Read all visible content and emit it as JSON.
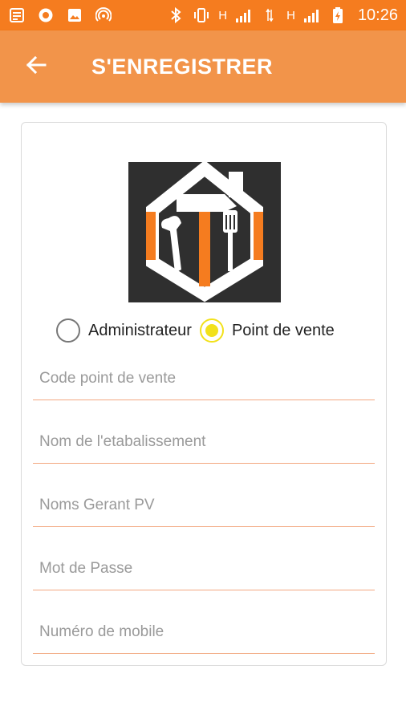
{
  "status_bar": {
    "time": "10:26",
    "network_label_1": "H",
    "network_label_2": "H",
    "icons": [
      "notes-icon",
      "chrome-icon",
      "image-icon",
      "hotspot-icon",
      "bluetooth-icon",
      "vibrate-icon",
      "signal-icon",
      "data-icon",
      "signal-icon",
      "battery-charging-icon"
    ]
  },
  "app_bar": {
    "back_icon": "arrow-left-icon",
    "title": "S'ENREGISTRER",
    "color": "#f2944a"
  },
  "logo": {
    "icon": "house-tools-logo"
  },
  "account_type": {
    "options": [
      {
        "label": "Administrateur",
        "checked": false
      },
      {
        "label": "Point de vente",
        "checked": true
      }
    ],
    "accent": "#f2e11a"
  },
  "form": {
    "fields": [
      {
        "placeholder": "Code point de vente",
        "value": ""
      },
      {
        "placeholder": "Nom de l'etabalissement",
        "value": ""
      },
      {
        "placeholder": "Noms Gerant PV",
        "value": ""
      },
      {
        "placeholder": "Mot de Passe",
        "value": ""
      },
      {
        "placeholder": "Numéro de mobile",
        "value": ""
      }
    ],
    "underline_color": "#f2a880"
  }
}
